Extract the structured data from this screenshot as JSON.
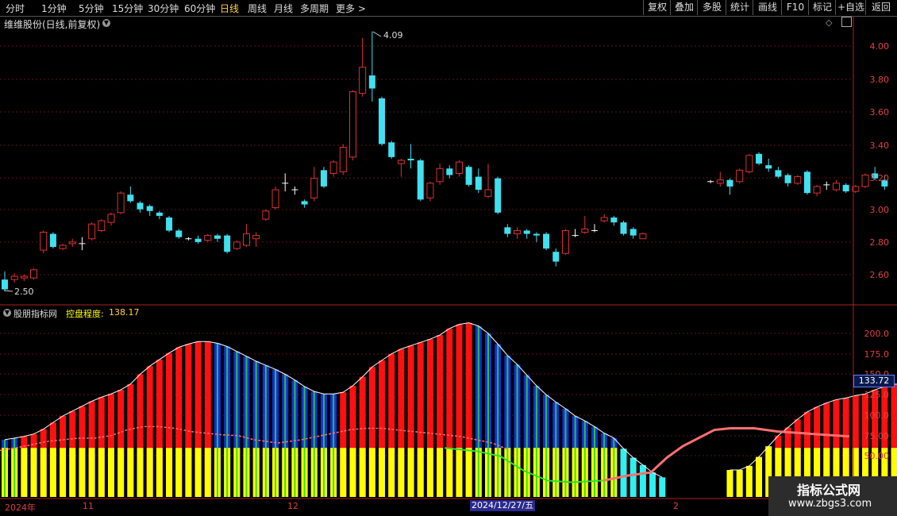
{
  "top_nav": {
    "periods": [
      "分时",
      "1分钟",
      "5分钟",
      "15分钟",
      "30分钟",
      "60分钟",
      "日线",
      "周线",
      "月线",
      "多周期",
      "更多 >"
    ],
    "active_period": "日线",
    "right_buttons": [
      "复权",
      "叠加",
      "多股",
      "统计",
      "画线",
      "F10",
      "标记",
      "+自选",
      "返回"
    ]
  },
  "chart_title": "维维股份(日线,前复权)",
  "indicator": {
    "name": "股朋指标网",
    "label": "控盘程度:",
    "value": "138.17"
  },
  "price_axis": [
    "4.00",
    "3.80",
    "3.60",
    "3.40",
    "3.20",
    "3.00",
    "2.80",
    "2.60"
  ],
  "indicator_axis": [
    "200.0",
    "175.0",
    "150.0",
    "125.0",
    "100.0",
    "75.00",
    "50.00"
  ],
  "current_indicator_value": "133.72",
  "annotations": {
    "high": "4.09",
    "low": "2.50"
  },
  "date_labels": {
    "year": "2024年",
    "m11": "11",
    "m12": "12",
    "highlight": "2024/12/27/五",
    "m2": "2"
  },
  "watermark": {
    "line1": "指标公式网",
    "line2": "www.zbgs3.com"
  },
  "colors": {
    "up": "#e03030",
    "down": "#40e0f0",
    "accent": "#ffd24a",
    "yellow_bar": "#ffff00",
    "blue_bar": "#1030e0",
    "red_bar": "#ff1010",
    "green_line": "#30e030",
    "pink_line": "#ff7070"
  },
  "chart_data": {
    "type": "candlestick",
    "title": "维维股份(日线,前复权)",
    "ylim": [
      2.45,
      4.15
    ],
    "candles": [
      [
        2.57,
        2.51,
        2.62,
        2.5
      ],
      [
        2.57,
        2.59,
        2.61,
        2.55
      ],
      [
        2.58,
        2.59,
        2.6,
        2.56
      ],
      [
        2.58,
        2.63,
        2.64,
        2.57
      ],
      [
        2.75,
        2.86,
        2.87,
        2.73
      ],
      [
        2.85,
        2.77,
        2.86,
        2.76
      ],
      [
        2.76,
        2.78,
        2.79,
        2.75
      ],
      [
        2.79,
        2.8,
        2.82,
        2.77
      ],
      [
        2.79,
        2.79,
        2.83,
        2.75
      ],
      [
        2.82,
        2.91,
        2.92,
        2.81
      ],
      [
        2.87,
        2.93,
        2.94,
        2.86
      ],
      [
        2.92,
        2.97,
        2.98,
        2.9
      ],
      [
        2.98,
        3.1,
        3.11,
        2.97
      ],
      [
        3.09,
        3.05,
        3.14,
        3.04
      ],
      [
        3.04,
        3.0,
        3.05,
        2.98
      ],
      [
        3.02,
        2.99,
        3.03,
        2.96
      ],
      [
        2.98,
        2.96,
        2.99,
        2.94
      ],
      [
        2.95,
        2.87,
        2.96,
        2.86
      ],
      [
        2.87,
        2.83,
        2.88,
        2.82
      ],
      [
        2.82,
        2.82,
        2.83,
        2.81
      ],
      [
        2.82,
        2.8,
        2.84,
        2.79
      ],
      [
        2.81,
        2.84,
        2.85,
        2.8
      ],
      [
        2.84,
        2.82,
        2.85,
        2.8
      ],
      [
        2.84,
        2.74,
        2.85,
        2.73
      ],
      [
        2.76,
        2.8,
        2.81,
        2.75
      ],
      [
        2.78,
        2.85,
        2.91,
        2.77
      ],
      [
        2.82,
        2.84,
        2.86,
        2.77
      ],
      [
        2.94,
        2.99,
        3.0,
        2.93
      ],
      [
        3.01,
        3.12,
        3.14,
        3.0
      ],
      [
        3.16,
        3.16,
        3.22,
        3.11
      ],
      [
        3.12,
        3.12,
        3.14,
        3.09
      ],
      [
        3.05,
        3.03,
        3.06,
        3.01
      ],
      [
        3.07,
        3.19,
        3.26,
        3.05
      ],
      [
        3.24,
        3.14,
        3.26,
        3.13
      ],
      [
        3.22,
        3.29,
        3.3,
        3.2
      ],
      [
        3.23,
        3.38,
        3.4,
        3.21
      ],
      [
        3.32,
        3.72,
        3.73,
        3.3
      ],
      [
        3.71,
        3.87,
        4.05,
        3.69
      ],
      [
        3.82,
        3.74,
        4.09,
        3.66
      ],
      [
        3.68,
        3.4,
        3.69,
        3.39
      ],
      [
        3.41,
        3.32,
        3.42,
        3.31
      ],
      [
        3.28,
        3.3,
        3.31,
        3.2
      ],
      [
        3.31,
        3.3,
        3.4,
        3.25
      ],
      [
        3.3,
        3.06,
        3.31,
        3.05
      ],
      [
        3.07,
        3.16,
        3.17,
        3.05
      ],
      [
        3.17,
        3.25,
        3.28,
        3.15
      ],
      [
        3.25,
        3.21,
        3.27,
        3.19
      ],
      [
        3.22,
        3.29,
        3.3,
        3.2
      ],
      [
        3.26,
        3.15,
        3.27,
        3.14
      ],
      [
        3.2,
        3.12,
        3.25,
        3.1
      ],
      [
        3.08,
        3.12,
        3.28,
        3.07
      ],
      [
        3.19,
        2.98,
        3.2,
        2.97
      ],
      [
        2.89,
        2.85,
        2.91,
        2.83
      ],
      [
        2.85,
        2.87,
        2.89,
        2.82
      ],
      [
        2.87,
        2.85,
        2.88,
        2.82
      ],
      [
        2.85,
        2.84,
        2.86,
        2.8
      ],
      [
        2.85,
        2.76,
        2.86,
        2.75
      ],
      [
        2.74,
        2.68,
        2.76,
        2.65
      ],
      [
        2.73,
        2.87,
        2.88,
        2.72
      ],
      [
        2.84,
        2.84,
        2.88,
        2.83
      ],
      [
        2.86,
        2.88,
        2.96,
        2.85
      ],
      [
        2.87,
        2.87,
        2.91,
        2.86
      ],
      [
        2.93,
        2.95,
        2.97,
        2.92
      ],
      [
        2.95,
        2.92,
        2.96,
        2.9
      ],
      [
        2.92,
        2.85,
        2.93,
        2.84
      ],
      [
        2.88,
        2.84,
        2.89,
        2.82
      ],
      [
        2.82,
        2.85,
        2.86,
        2.82
      ],
      null,
      null,
      null,
      null,
      null,
      null,
      [
        3.17,
        3.17,
        3.18,
        3.16
      ],
      [
        3.16,
        3.18,
        3.23,
        3.14
      ],
      [
        3.18,
        3.14,
        3.19,
        3.09
      ],
      [
        3.17,
        3.24,
        3.25,
        3.16
      ],
      [
        3.23,
        3.33,
        3.34,
        3.22
      ],
      [
        3.34,
        3.28,
        3.35,
        3.27
      ],
      [
        3.27,
        3.25,
        3.31,
        3.23
      ],
      [
        3.24,
        3.2,
        3.26,
        3.19
      ],
      [
        3.21,
        3.16,
        3.22,
        3.14
      ],
      [
        3.16,
        3.2,
        3.21,
        3.15
      ],
      [
        3.23,
        3.1,
        3.24,
        3.09
      ],
      [
        3.1,
        3.14,
        3.15,
        3.08
      ],
      [
        3.15,
        3.15,
        3.17,
        3.12
      ],
      [
        3.12,
        3.16,
        3.18,
        3.11
      ],
      [
        3.15,
        3.11,
        3.16,
        3.1
      ],
      [
        3.11,
        3.14,
        3.15,
        3.1
      ],
      [
        3.14,
        3.21,
        3.22,
        3.13
      ],
      [
        3.22,
        3.19,
        3.26,
        3.18
      ],
      [
        3.18,
        3.14,
        3.21,
        3.12
      ]
    ],
    "indicator_series": {
      "name": "控盘程度",
      "ylim": [
        0,
        222
      ],
      "bars": [
        {
          "v": 70,
          "c": "b"
        },
        {
          "v": 72,
          "c": "b"
        },
        {
          "v": 74,
          "c": "r"
        },
        {
          "v": 77,
          "c": "r"
        },
        {
          "v": 83,
          "c": "r"
        },
        {
          "v": 91,
          "c": "r"
        },
        {
          "v": 99,
          "c": "r"
        },
        {
          "v": 105,
          "c": "r"
        },
        {
          "v": 111,
          "c": "r"
        },
        {
          "v": 117,
          "c": "r"
        },
        {
          "v": 122,
          "c": "r"
        },
        {
          "v": 126,
          "c": "r"
        },
        {
          "v": 131,
          "c": "r"
        },
        {
          "v": 138,
          "c": "r"
        },
        {
          "v": 150,
          "c": "r"
        },
        {
          "v": 160,
          "c": "r"
        },
        {
          "v": 168,
          "c": "r"
        },
        {
          "v": 176,
          "c": "r"
        },
        {
          "v": 183,
          "c": "r"
        },
        {
          "v": 187,
          "c": "r"
        },
        {
          "v": 190,
          "c": "r"
        },
        {
          "v": 190,
          "c": "r"
        },
        {
          "v": 188,
          "c": "b"
        },
        {
          "v": 184,
          "c": "b"
        },
        {
          "v": 178,
          "c": "b"
        },
        {
          "v": 172,
          "c": "b"
        },
        {
          "v": 166,
          "c": "b"
        },
        {
          "v": 161,
          "c": "b"
        },
        {
          "v": 156,
          "c": "b"
        },
        {
          "v": 150,
          "c": "b"
        },
        {
          "v": 143,
          "c": "b"
        },
        {
          "v": 135,
          "c": "b"
        },
        {
          "v": 129,
          "c": "b"
        },
        {
          "v": 126,
          "c": "b"
        },
        {
          "v": 126,
          "c": "b"
        },
        {
          "v": 128,
          "c": "r"
        },
        {
          "v": 136,
          "c": "r"
        },
        {
          "v": 147,
          "c": "r"
        },
        {
          "v": 159,
          "c": "r"
        },
        {
          "v": 167,
          "c": "r"
        },
        {
          "v": 175,
          "c": "r"
        },
        {
          "v": 181,
          "c": "r"
        },
        {
          "v": 185,
          "c": "r"
        },
        {
          "v": 189,
          "c": "r"
        },
        {
          "v": 193,
          "c": "r"
        },
        {
          "v": 198,
          "c": "r"
        },
        {
          "v": 206,
          "c": "r"
        },
        {
          "v": 211,
          "c": "r"
        },
        {
          "v": 213,
          "c": "r"
        },
        {
          "v": 209,
          "c": "b"
        },
        {
          "v": 200,
          "c": "b"
        },
        {
          "v": 187,
          "c": "b"
        },
        {
          "v": 173,
          "c": "b"
        },
        {
          "v": 162,
          "c": "b"
        },
        {
          "v": 149,
          "c": "b"
        },
        {
          "v": 136,
          "c": "b"
        },
        {
          "v": 125,
          "c": "b"
        },
        {
          "v": 116,
          "c": "b"
        },
        {
          "v": 108,
          "c": "b"
        },
        {
          "v": 99,
          "c": "b"
        },
        {
          "v": 93,
          "c": "b"
        },
        {
          "v": 86,
          "c": "b"
        },
        {
          "v": 78,
          "c": "b"
        },
        {
          "v": 72,
          "c": "b"
        },
        {
          "v": 59,
          "c": "c"
        },
        {
          "v": 48,
          "c": "c"
        },
        {
          "v": 39,
          "c": "c"
        },
        {
          "v": 30,
          "c": "c"
        },
        {
          "v": 24,
          "c": "c"
        },
        null,
        null,
        null,
        null,
        null,
        null,
        {
          "v": 33,
          "c": "y"
        },
        {
          "v": 33,
          "c": "y"
        },
        {
          "v": 38,
          "c": "y"
        },
        {
          "v": 49,
          "c": "y"
        },
        {
          "v": 62,
          "c": "y"
        },
        {
          "v": 75,
          "c": "r"
        },
        {
          "v": 85,
          "c": "r"
        },
        {
          "v": 95,
          "c": "r"
        },
        {
          "v": 104,
          "c": "r"
        },
        {
          "v": 110,
          "c": "r"
        },
        {
          "v": 115,
          "c": "r"
        },
        {
          "v": 119,
          "c": "r"
        },
        {
          "v": 121,
          "c": "r"
        },
        {
          "v": 124,
          "c": "r"
        },
        {
          "v": 126,
          "c": "r"
        },
        {
          "v": 131,
          "c": "r"
        },
        {
          "v": 135,
          "c": "r"
        },
        {
          "v": 138,
          "c": "r"
        },
        {
          "v": 138,
          "c": "r"
        }
      ]
    }
  }
}
